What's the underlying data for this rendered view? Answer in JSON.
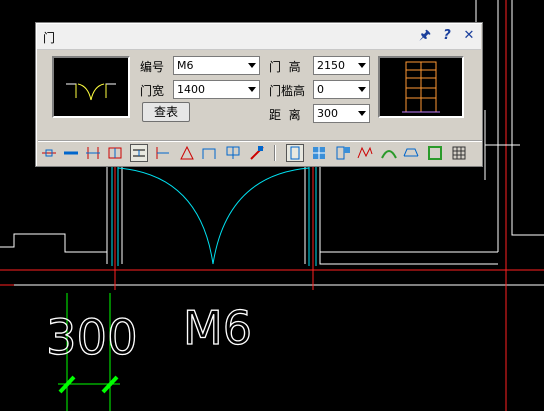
{
  "dialog": {
    "title": "门",
    "titlebar_icons": [
      "pin-icon",
      "help-icon",
      "close-icon"
    ],
    "fields": {
      "number_label": "编号",
      "number_value": "M6",
      "width_label": "门宽",
      "width_value": "1400",
      "height_label": "门  高",
      "height_value": "2150",
      "sill_label": "门槛高",
      "sill_value": "0",
      "distance_label": "距  离",
      "distance_value": "300"
    },
    "lookup_button": "查表",
    "toolbar_icons": [
      "insert-free-icon",
      "insert-along-wall-icon",
      "insert-center-icon",
      "insert-axis-icon",
      "insert-offset-icon",
      "insert-wall-segment-icon",
      "insert-angle-icon",
      "insert-arc-icon",
      "insert-grid-icon",
      "replace-icon",
      "door-type-icon",
      "window-type-icon",
      "door-window-icon",
      "sub-door-icon",
      "arc-window-icon",
      "bay-window-icon",
      "hole-icon",
      "grid-window-icon"
    ],
    "active_tools": [
      4,
      10
    ]
  },
  "drawing": {
    "door_tag": "M6",
    "dimension_text": "300"
  },
  "colors": {
    "cad_background": "#000000",
    "wall_line": "#ffffff",
    "axis_line": "#ff2020",
    "door_arc": "#00ffff",
    "dimension": "#00ff00",
    "dialog_face": "#d4d0c8"
  }
}
